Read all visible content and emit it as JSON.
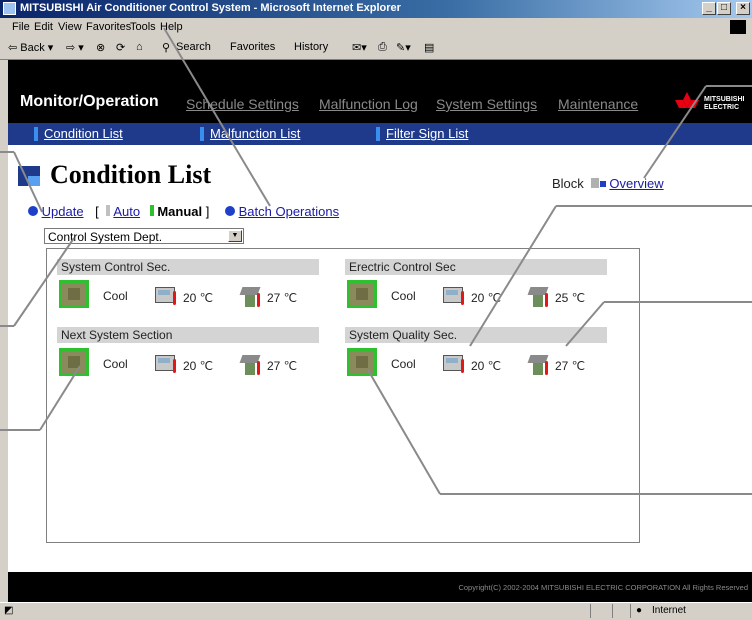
{
  "window": {
    "title": "MITSUBISHI Air Conditioner Control System - Microsoft Internet Explorer",
    "buttons": [
      "_",
      "□",
      "×"
    ]
  },
  "menu": [
    "File",
    "Edit",
    "View",
    "Favorites",
    "Tools",
    "Help"
  ],
  "toolbar": {
    "back": "⇦ Back ▾",
    "forward": "⇨ ▾",
    "search": "Search",
    "favorites": "Favorites",
    "history": "History"
  },
  "header": {
    "active": "Monitor/Operation",
    "tabs": [
      "Schedule Settings",
      "Malfunction Log",
      "System Settings",
      "Maintenance"
    ],
    "logo_text_1": "MITSUBISHI",
    "logo_text_2": "ELECTRIC"
  },
  "subnav": [
    "Condition List",
    "Malfunction List",
    "Filter Sign List"
  ],
  "page": {
    "title": "Condition List",
    "block_label": "Block",
    "overview": "Overview",
    "update": "Update",
    "open_bracket": "[",
    "auto": "Auto",
    "manual": "Manual",
    "close_bracket": "]",
    "batch": "Batch Operations",
    "select_value": "Control System Dept."
  },
  "groups": [
    {
      "name": "System Control Sec.",
      "mode": "Cool",
      "set_temp": "20 ℃",
      "room_temp": "27 ℃"
    },
    {
      "name": "Erectric Control Sec",
      "mode": "Cool",
      "set_temp": "20 ℃",
      "room_temp": "25 ℃"
    },
    {
      "name": "Next System Section",
      "mode": "Cool",
      "set_temp": "20 ℃",
      "room_temp": "27 ℃"
    },
    {
      "name": "System Quality Sec.",
      "mode": "Cool",
      "set_temp": "20 ℃",
      "room_temp": "27 ℃"
    }
  ],
  "footer": "Copyright(C) 2002-2004 MITSUBISHI ELECTRIC CORPORATION All Rights Reserved",
  "status": {
    "zone": "Internet"
  },
  "colors": {
    "header_bg": "#000000",
    "subnav_bg": "#1f3a8a",
    "accent_blue": "#1e40c8",
    "running_green": "#2ec02e"
  }
}
